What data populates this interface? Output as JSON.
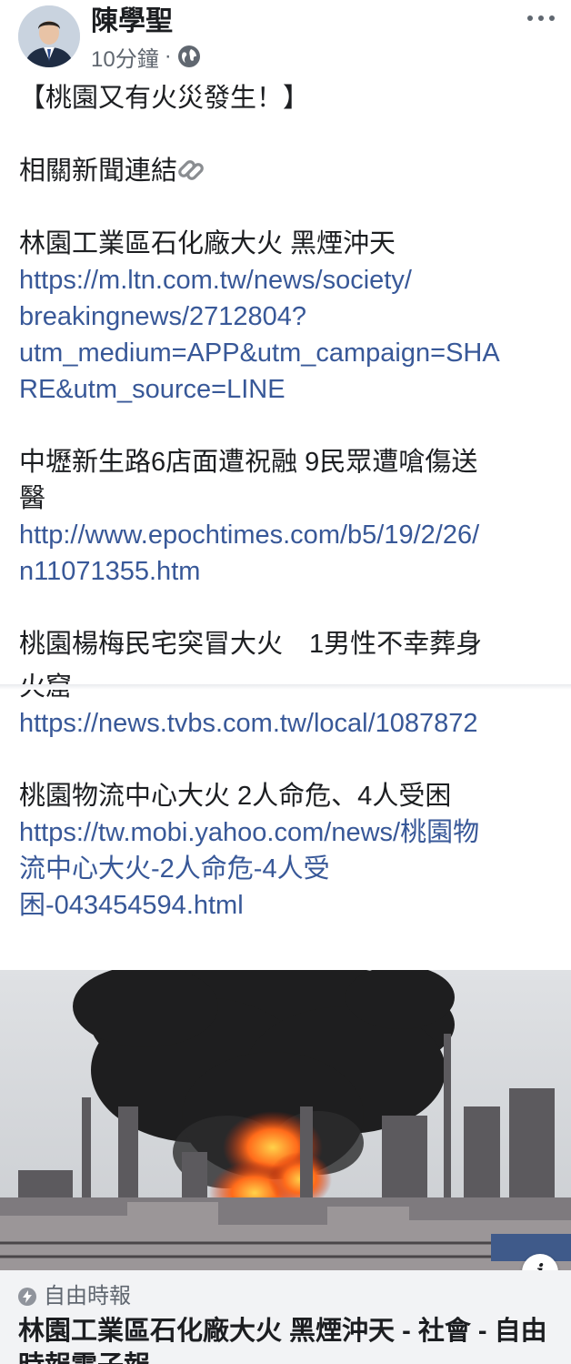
{
  "post": {
    "author": "陳學聖",
    "time": "10分鐘",
    "separator": "·",
    "privacy_icon": "globe-icon",
    "more_icon": "more-horizontal-icon"
  },
  "body": {
    "headline": "【桃園又有火災發生！】",
    "related_label": "相關新聞連結",
    "link_icon": "link-icon",
    "news": [
      {
        "title_lines": [
          "林園工業區石化廠大火 黑煙沖天"
        ],
        "url_lines": [
          "https://m.ltn.com.tw/news/society/",
          "breakingnews/2712804?",
          "utm_medium=APP&utm_campaign=SHA",
          "RE&utm_source=LINE"
        ]
      },
      {
        "title_lines": [
          "中壢新生路6店面遭祝融 9民眾遭嗆傷送",
          "醫"
        ],
        "url_lines": [
          "http://www.epochtimes.com/b5/19/2/26/",
          "n11071355.htm"
        ]
      },
      {
        "title_lines": [
          "桃園楊梅民宅突冒大火　1男性不幸葬身",
          "火窟"
        ],
        "url_lines": [
          "https://news.tvbs.com.tw/local/1087872"
        ]
      },
      {
        "title_lines": [
          "桃園物流中心大火 2人命危、4人受困"
        ],
        "url_lines": [
          "https://tw.mobi.yahoo.com/news/桃園物",
          "流中心大火-2人命危-4人受",
          "困-043454594.html"
        ]
      }
    ]
  },
  "preview": {
    "image_icon": "fire-photo",
    "info_label": "i",
    "source": "自由時報",
    "title": "林園工業區石化廠大火 黑煙沖天 - 社會 - 自由時報電子報"
  },
  "colors": {
    "link": "#385898",
    "text": "#1c1e21",
    "meta": "#606770",
    "caption_bg": "#f2f3f5"
  }
}
